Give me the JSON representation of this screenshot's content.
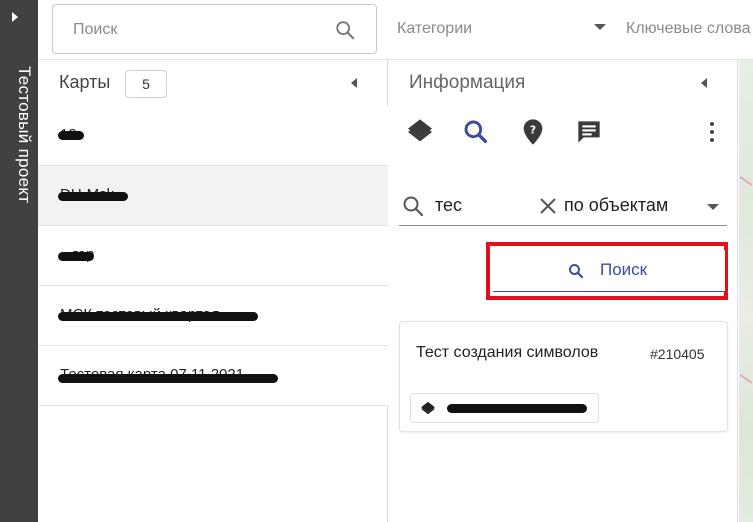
{
  "sidebar": {
    "project_title": "Тестовый проект"
  },
  "topbar": {
    "search_placeholder": "Поиск",
    "categories_label": "Категории",
    "keywords_label": "Ключевые слова"
  },
  "maps": {
    "title": "Карты",
    "count": "5",
    "items": [
      {
        "label": "12"
      },
      {
        "label": "DH-Msk"
      },
      {
        "label": "...гор"
      },
      {
        "label": "МСК тестовый квартал"
      },
      {
        "label": "Тестовая карта 07.11.2021"
      }
    ]
  },
  "info": {
    "title": "Информация",
    "toolbar_icons": [
      "layers-icon",
      "search-icon",
      "place-icon",
      "comment-icon",
      "more-vert-icon"
    ],
    "query": {
      "value": "тес",
      "mode": "по объектам"
    },
    "search_button": "Поиск",
    "results": [
      {
        "title": "Тест создания символов",
        "id": "#210405",
        "layer_icon": "layers-icon"
      }
    ]
  },
  "colors": {
    "rail_bg": "#3f4143",
    "accent": "#3f4a9a",
    "highlight": "#e3101b"
  }
}
